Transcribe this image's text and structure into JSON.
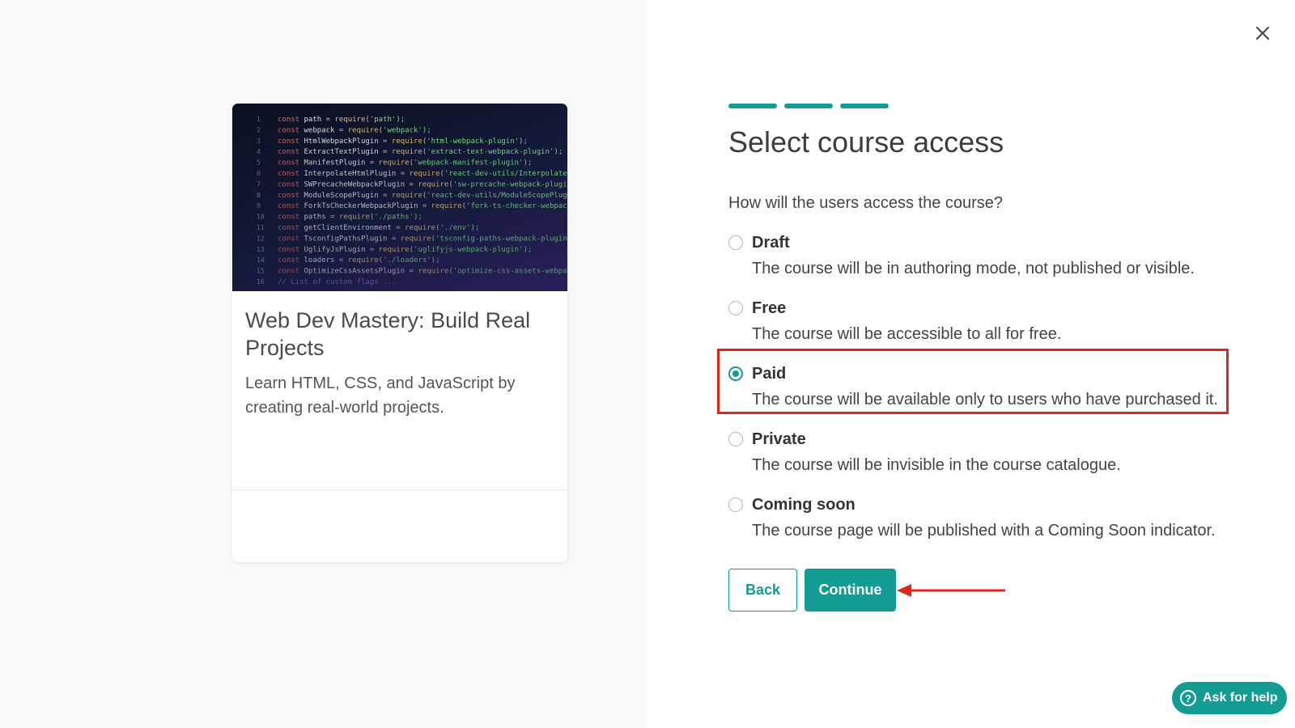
{
  "course": {
    "title": "Web Dev Mastery: Build Real Projects",
    "description": "Learn HTML, CSS, and JavaScript by creating real-world projects.",
    "image_code_lines": [
      "const path = require('path');",
      "const webpack = require('webpack');",
      "const HtmlWebpackPlugin = require('html-webpack-plugin');",
      "const ExtractTextPlugin = require('extract-text-webpack-plugin');",
      "const ManifestPlugin = require('webpack-manifest-plugin');",
      "const InterpolateHtmlPlugin = require('react-dev-utils/InterpolateHtmlPlugin');",
      "const SWPrecacheWebpackPlugin = require('sw-precache-webpack-plugin');",
      "const ModuleScopePlugin = require('react-dev-utils/ModuleScopePlugin');",
      "const ForkTsCheckerWebpackPlugin = require('fork-ts-checker-webpack-plugin');",
      "const paths = require('./paths');",
      "const getClientEnvironment = require('./env');",
      "const TsconfigPathsPlugin = require('tsconfig-paths-webpack-plugin');",
      "const UglifyJsPlugin = require('uglifyjs-webpack-plugin');",
      "const loaders = require('./loaders');",
      "const OptimizeCssAssetsPlugin = require('optimize-css-assets-webpack-plugin');",
      "// List of custom flags ..."
    ]
  },
  "wizard": {
    "title": "Select course access",
    "question": "How will the users access the course?",
    "progress_steps_completed": 3,
    "selected_option": "Paid",
    "options": [
      {
        "label": "Draft",
        "description": "The course will be in authoring mode, not published or visible."
      },
      {
        "label": "Free",
        "description": "The course will be accessible to all for free."
      },
      {
        "label": "Paid",
        "description": "The course will be available only to users who have purchased it."
      },
      {
        "label": "Private",
        "description": "The course will be invisible in the course catalogue."
      },
      {
        "label": "Coming soon",
        "description": "The course page will be published with a Coming Soon indicator."
      }
    ],
    "back_label": "Back",
    "continue_label": "Continue"
  },
  "help": {
    "label": "Ask for help",
    "icon_glyph": "?"
  },
  "icons": {
    "close": "close-icon",
    "help": "question-circle-icon"
  },
  "colors": {
    "accent": "#129c93",
    "annotation": "#e0271f"
  }
}
